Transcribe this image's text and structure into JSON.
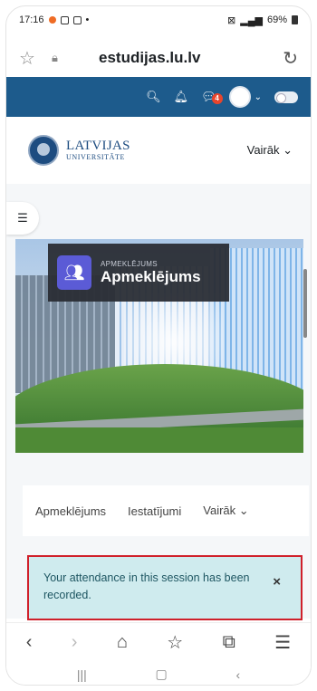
{
  "status_bar": {
    "time": "17:16",
    "battery_text": "69%"
  },
  "url_bar": {
    "url": "estudijas.lu.lv"
  },
  "navbar": {
    "notification_count": "4"
  },
  "header": {
    "logo_line1": "LATVIJAS",
    "logo_line2": "UNIVERSITĀTE",
    "more_label": "Vairāk ⌄"
  },
  "activity": {
    "type_label": "APMEKLĒJUMS",
    "title": "Apmeklējums"
  },
  "secondary_nav": {
    "items": [
      "Apmeklējums",
      "Iestatījumi",
      "Vairāk ⌄"
    ]
  },
  "alert": {
    "message": "Your attendance in this session has been recorded.",
    "close_label": "×"
  },
  "colors": {
    "navbar": "#1d5b8c",
    "activity_icon": "#5b5bd6",
    "alert_bg": "#cfebee",
    "alert_highlight": "#d0202b"
  }
}
